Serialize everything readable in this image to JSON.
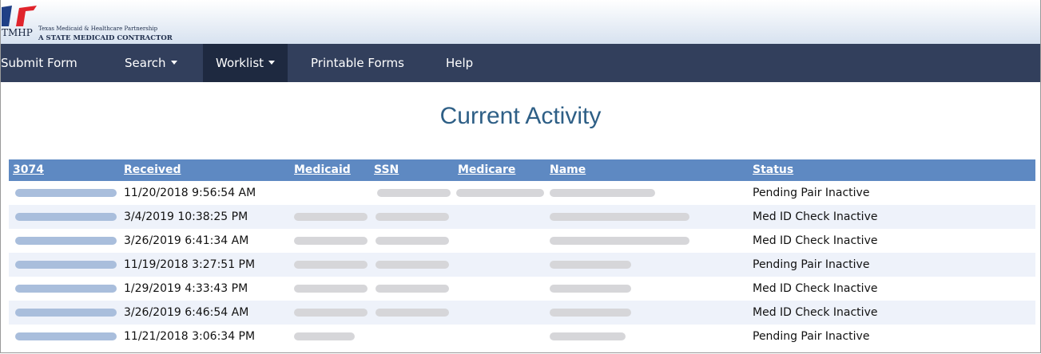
{
  "header": {
    "logo_acronym": "TMHP",
    "logo_line1": "Texas Medicaid & Healthcare Partnership",
    "logo_line2": "A STATE MEDICAID CONTRACTOR"
  },
  "nav": {
    "items": [
      {
        "label": "Submit Form"
      },
      {
        "label": "Search"
      },
      {
        "label": "Worklist"
      },
      {
        "label": "Printable Forms"
      },
      {
        "label": "Help"
      }
    ]
  },
  "page_title": "Current Activity",
  "table": {
    "headers": [
      "3074",
      "Received",
      "Medicaid",
      "SSN",
      "Medicare",
      "Name",
      "Status"
    ],
    "rows": [
      {
        "received": "11/20/2018 9:56:54 AM",
        "status": "Pending Pair Inactive"
      },
      {
        "received": "3/4/2019 10:38:25 PM",
        "status": "Med ID Check Inactive"
      },
      {
        "received": "3/26/2019 6:41:34 AM",
        "status": "Med ID Check Inactive"
      },
      {
        "received": "11/19/2018 3:27:51 PM",
        "status": "Pending Pair Inactive"
      },
      {
        "received": "1/29/2019 4:33:43 PM",
        "status": "Med ID Check Inactive"
      },
      {
        "received": "3/26/2019 6:46:54 AM",
        "status": "Med ID Check Inactive"
      },
      {
        "received": "11/21/2018 3:06:34 PM",
        "status": "Pending Pair Inactive"
      }
    ]
  },
  "colors": {
    "nav_bg": "#323f5c",
    "nav_active_bg": "#1e2940",
    "table_header_bg": "#5e89c2",
    "title_color": "#2e5f86",
    "logo_red": "#e0242c",
    "logo_blue": "#1f3f86"
  },
  "icons": [
    "tmhp-logo",
    "caret-down-icon"
  ]
}
